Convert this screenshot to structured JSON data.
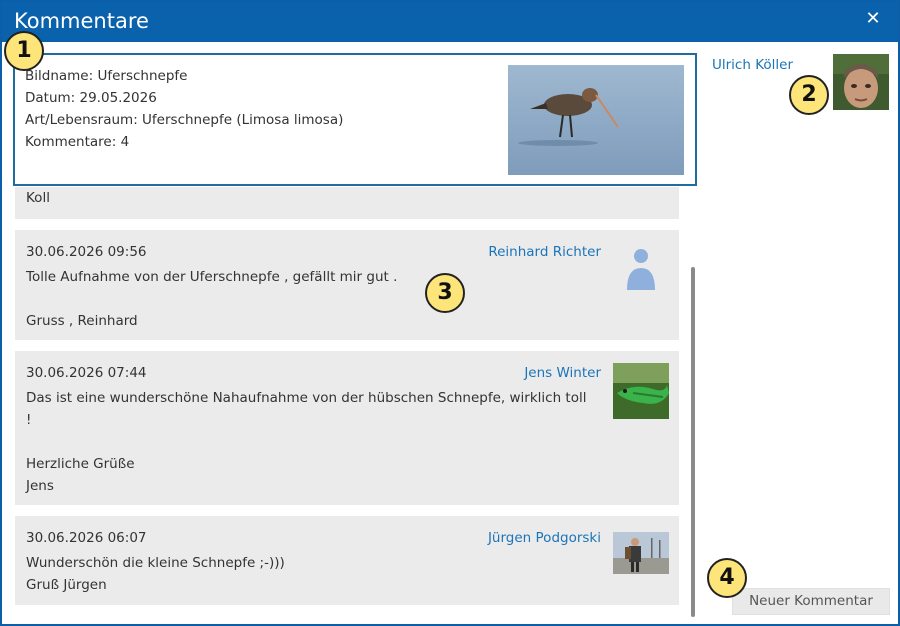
{
  "dialog": {
    "title": "Kommentare",
    "close_symbol": "✕"
  },
  "photo_info": {
    "bildname": "Bildname: Uferschnepfe",
    "datum": "Datum: 29.05.2026",
    "art": "Art/Lebensraum: Uferschnepfe (Limosa limosa)",
    "kommentare": "Kommentare: 4",
    "image_icon": "godwit-photo"
  },
  "owner": {
    "name": "Ulrich Köller",
    "avatar_icon": "user-photo"
  },
  "comments": [
    {
      "date": "",
      "author": "",
      "text": "Koll",
      "avatar_icon": ""
    },
    {
      "date": "30.06.2026 09:56",
      "author": "Reinhard Richter",
      "text": "Tolle Aufnahme von der Uferschnepfe , gefällt mir gut .\n\nGruss , Reinhard",
      "avatar_icon": "default-person-icon"
    },
    {
      "date": "30.06.2026 07:44",
      "author": "Jens Winter",
      "text": "Das ist eine wunderschöne Nahaufnahme von der hübschen Schnepfe, wirklich toll !\n\nHerzliche Grüße\nJens",
      "avatar_icon": "lizard-photo"
    },
    {
      "date": "30.06.2026 06:07",
      "author": "Jürgen Podgorski",
      "text": "Wunderschön die kleine Schnepfe ;-)))\nGruß Jürgen",
      "avatar_icon": "hiker-photo"
    }
  ],
  "new_comment_button": "Neuer Kommentar",
  "markers": [
    "1",
    "2",
    "3",
    "4"
  ],
  "colors": {
    "header": "#0a62ad",
    "link": "#1b75b8",
    "comment_bg": "#ebebeb",
    "marker_fill": "#fde57a"
  }
}
